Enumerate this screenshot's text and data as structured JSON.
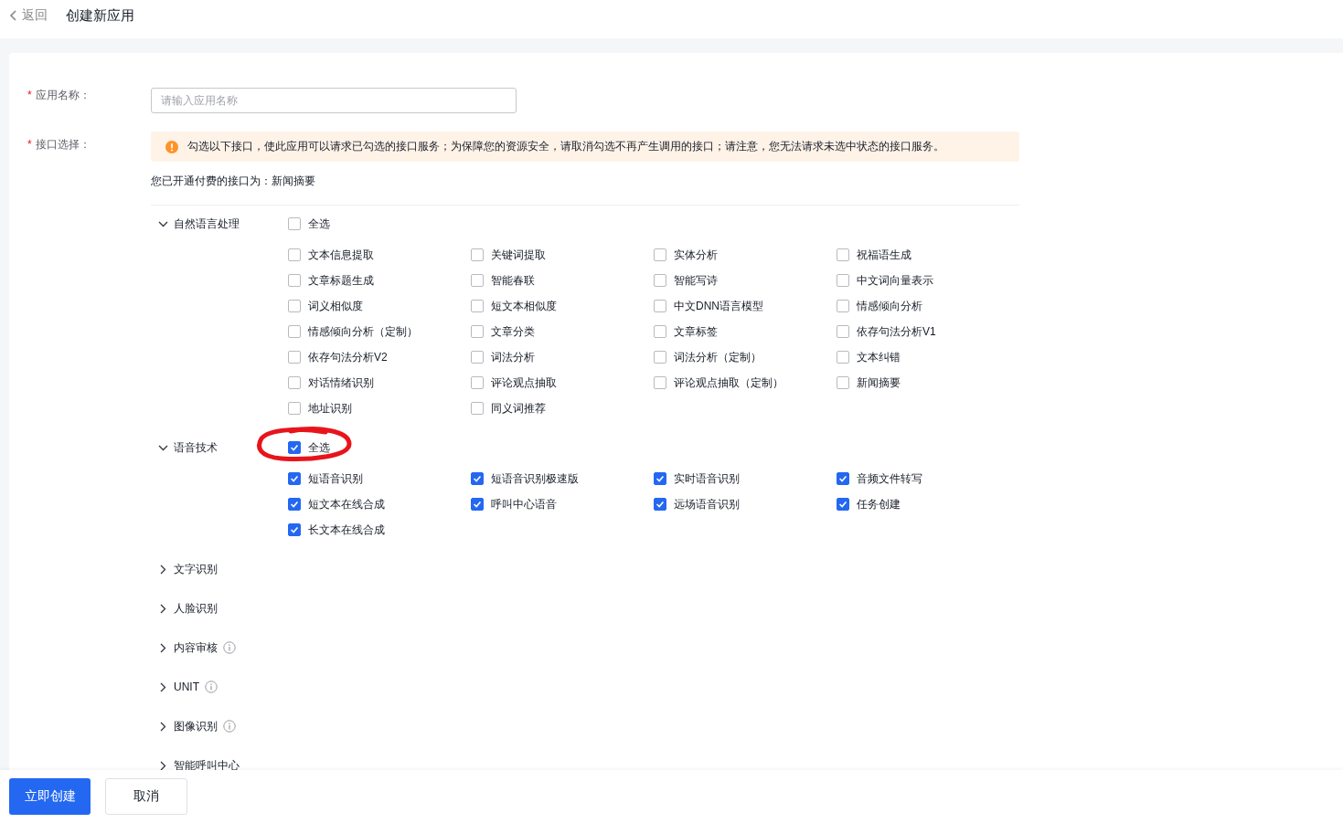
{
  "header": {
    "back": "返回",
    "title": "创建新应用"
  },
  "form": {
    "name_field": {
      "required_mark": "*",
      "label": "应用名称：",
      "placeholder": "请输入应用名称"
    },
    "api_field": {
      "required_mark": "*",
      "label": "接口选择：",
      "notice": "勾选以下接口，使此应用可以请求已勾选的接口服务；为保障您的资源安全，请取消勾选不再产生调用的接口；请注意，您无法请求未选中状态的接口服务。",
      "paid_note": "您已开通付费的接口为：新闻摘要"
    }
  },
  "categories": [
    {
      "name": "自然语言处理",
      "expanded": true,
      "has_info": false,
      "select_all": {
        "label": "全选",
        "checked": false
      },
      "items": [
        {
          "label": "文本信息提取",
          "checked": false
        },
        {
          "label": "关键词提取",
          "checked": false
        },
        {
          "label": "实体分析",
          "checked": false
        },
        {
          "label": "祝福语生成",
          "checked": false
        },
        {
          "label": "文章标题生成",
          "checked": false
        },
        {
          "label": "智能春联",
          "checked": false
        },
        {
          "label": "智能写诗",
          "checked": false
        },
        {
          "label": "中文词向量表示",
          "checked": false
        },
        {
          "label": "词义相似度",
          "checked": false
        },
        {
          "label": "短文本相似度",
          "checked": false
        },
        {
          "label": "中文DNN语言模型",
          "checked": false
        },
        {
          "label": "情感倾向分析",
          "checked": false
        },
        {
          "label": "情感倾向分析（定制）",
          "checked": false
        },
        {
          "label": "文章分类",
          "checked": false
        },
        {
          "label": "文章标签",
          "checked": false
        },
        {
          "label": "依存句法分析V1",
          "checked": false
        },
        {
          "label": "依存句法分析V2",
          "checked": false
        },
        {
          "label": "词法分析",
          "checked": false
        },
        {
          "label": "词法分析（定制）",
          "checked": false
        },
        {
          "label": "文本纠错",
          "checked": false
        },
        {
          "label": "对话情绪识别",
          "checked": false
        },
        {
          "label": "评论观点抽取",
          "checked": false
        },
        {
          "label": "评论观点抽取（定制）",
          "checked": false
        },
        {
          "label": "新闻摘要",
          "checked": false
        },
        {
          "label": "地址识别",
          "checked": false
        },
        {
          "label": "同义词推荐",
          "checked": false
        }
      ]
    },
    {
      "name": "语音技术",
      "expanded": true,
      "has_info": false,
      "select_all": {
        "label": "全选",
        "checked": true
      },
      "items": [
        {
          "label": "短语音识别",
          "checked": true
        },
        {
          "label": "短语音识别极速版",
          "checked": true
        },
        {
          "label": "实时语音识别",
          "checked": true
        },
        {
          "label": "音频文件转写",
          "checked": true
        },
        {
          "label": "短文本在线合成",
          "checked": true
        },
        {
          "label": "呼叫中心语音",
          "checked": true
        },
        {
          "label": "远场语音识别",
          "checked": true
        },
        {
          "label": "任务创建",
          "checked": true
        },
        {
          "label": "长文本在线合成",
          "checked": true
        }
      ]
    },
    {
      "name": "文字识别",
      "expanded": false,
      "has_info": false
    },
    {
      "name": "人脸识别",
      "expanded": false,
      "has_info": false
    },
    {
      "name": "内容审核",
      "expanded": false,
      "has_info": true
    },
    {
      "name": "UNIT",
      "expanded": false,
      "has_info": true
    },
    {
      "name": "图像识别",
      "expanded": false,
      "has_info": true
    },
    {
      "name": "智能呼叫中心",
      "expanded": false,
      "has_info": false
    }
  ],
  "buttons": [
    {
      "label": "立即创建",
      "kind": "primary"
    },
    {
      "label": "取消",
      "kind": "default"
    }
  ]
}
